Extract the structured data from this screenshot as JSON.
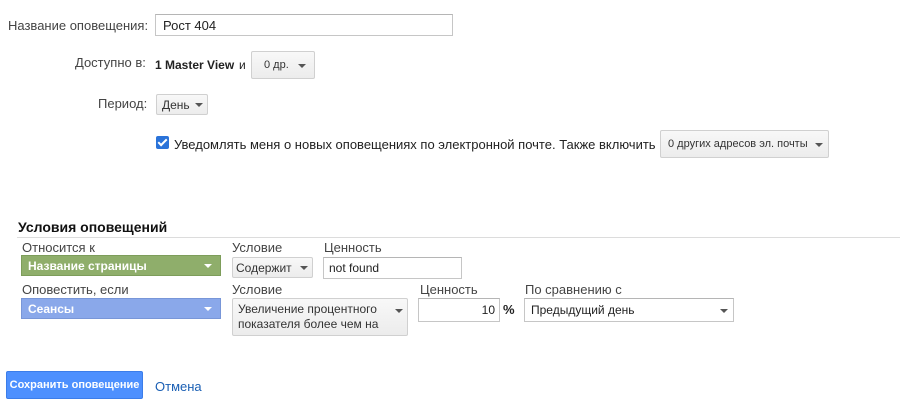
{
  "form": {
    "name_label": "Название оповещения:",
    "name_value": "Рост 404",
    "available_label": "Доступно в:",
    "available_view": "1 Master View",
    "available_and": "и",
    "available_more": "0 др.",
    "period_label": "Период:",
    "period_value": "День",
    "notify_checked": true,
    "notify_text": "Уведомлять меня о новых оповещениях по электронной почте. Также включить",
    "emails_value": "0 других адресов эл. почты"
  },
  "conditions": {
    "title": "Условия оповещений",
    "applies_to_label": "Относится к",
    "applies_to_value": "Название страницы",
    "condition_label_1": "Условие",
    "condition_value_1": "Содержит",
    "value_label_1": "Ценность",
    "value_value_1": "not found",
    "alert_if_label": "Оповестить, если",
    "alert_if_value": "Сеансы",
    "condition_label_2": "Условие",
    "condition_value_2_line1": "Увеличение процентного",
    "condition_value_2_line2": "показателя более чем на",
    "value_label_2": "Ценность",
    "value_value_2": "10",
    "percent_sign": "%",
    "compared_label": "По сравнению с",
    "compared_value": "Предыдущий день"
  },
  "actions": {
    "save_label": "Сохранить оповещение",
    "cancel_label": "Отмена"
  },
  "colors": {
    "green_dimension": "#8fae6b",
    "blue_metric": "#8aa8ea",
    "primary_button": "#4d90fe",
    "link": "#1a5fb4"
  }
}
